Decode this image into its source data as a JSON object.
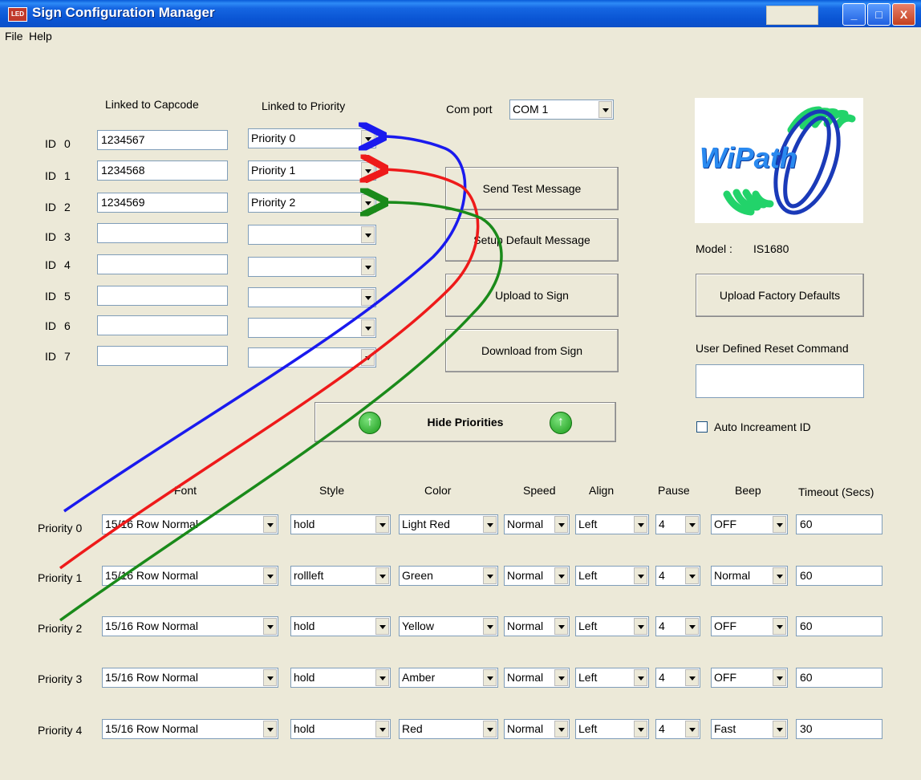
{
  "window": {
    "title": "Sign Configuration Manager",
    "icon_label": "LED",
    "controls": {
      "minimize": "_",
      "maximize": "□",
      "close": "X"
    }
  },
  "menu": {
    "file": "File",
    "help": "Help"
  },
  "ids": {
    "col_capcode": "Linked to Capcode",
    "col_priority": "Linked to Priority",
    "rows": [
      {
        "label": "ID",
        "num": "0",
        "capcode": "1234567",
        "priority": "Priority 0"
      },
      {
        "label": "ID",
        "num": "1",
        "capcode": "1234568",
        "priority": "Priority 1"
      },
      {
        "label": "ID",
        "num": "2",
        "capcode": "1234569",
        "priority": "Priority 2"
      },
      {
        "label": "ID",
        "num": "3",
        "capcode": "",
        "priority": ""
      },
      {
        "label": "ID",
        "num": "4",
        "capcode": "",
        "priority": ""
      },
      {
        "label": "ID",
        "num": "5",
        "capcode": "",
        "priority": ""
      },
      {
        "label": "ID",
        "num": "6",
        "capcode": "",
        "priority": ""
      },
      {
        "label": "ID",
        "num": "7",
        "capcode": "",
        "priority": ""
      }
    ]
  },
  "comport": {
    "label": "Com port",
    "value": "COM 1"
  },
  "buttons": {
    "send_test": "Send Test Message",
    "setup_default": "Setup Default Message",
    "upload_sign": "Upload to Sign",
    "download_sign": "Download from Sign",
    "hide_priorities": "Hide Priorities",
    "upload_factory": "Upload Factory Defaults"
  },
  "logo": {
    "text": "WiPath",
    "alt": "wipath-logo"
  },
  "model": {
    "label": "Model :",
    "value": "IS1680"
  },
  "reset": {
    "label": "User Defined Reset Command",
    "value": ""
  },
  "auto_increment": {
    "label": "Auto Increament ID",
    "checked": false
  },
  "priorities": {
    "headers": {
      "font": "Font",
      "style": "Style",
      "color": "Color",
      "speed": "Speed",
      "align": "Align",
      "pause": "Pause",
      "beep": "Beep",
      "timeout": "Timeout (Secs)"
    },
    "rows": [
      {
        "label": "Priority 0",
        "font": "15/16 Row Normal",
        "style": "hold",
        "color": "Light Red",
        "speed": "Normal",
        "align": "Left",
        "pause": "4",
        "beep": "OFF",
        "timeout": "60"
      },
      {
        "label": "Priority 1",
        "font": "15/16 Row Normal",
        "style": "rollleft",
        "color": "Green",
        "speed": "Normal",
        "align": "Left",
        "pause": "4",
        "beep": "Normal",
        "timeout": "60"
      },
      {
        "label": "Priority 2",
        "font": "15/16 Row Normal",
        "style": "hold",
        "color": "Yellow",
        "speed": "Normal",
        "align": "Left",
        "pause": "4",
        "beep": "OFF",
        "timeout": "60"
      },
      {
        "label": "Priority 3",
        "font": "15/16 Row Normal",
        "style": "hold",
        "color": "Amber",
        "speed": "Normal",
        "align": "Left",
        "pause": "4",
        "beep": "OFF",
        "timeout": "60"
      },
      {
        "label": "Priority 4",
        "font": "15/16 Row Normal",
        "style": "hold",
        "color": "Red",
        "speed": "Normal",
        "align": "Left",
        "pause": "4",
        "beep": "Fast",
        "timeout": "30"
      }
    ]
  },
  "annotation_colors": {
    "priority0": "#1a1aee",
    "priority1": "#ee1a1a",
    "priority2": "#1a8a1a"
  }
}
